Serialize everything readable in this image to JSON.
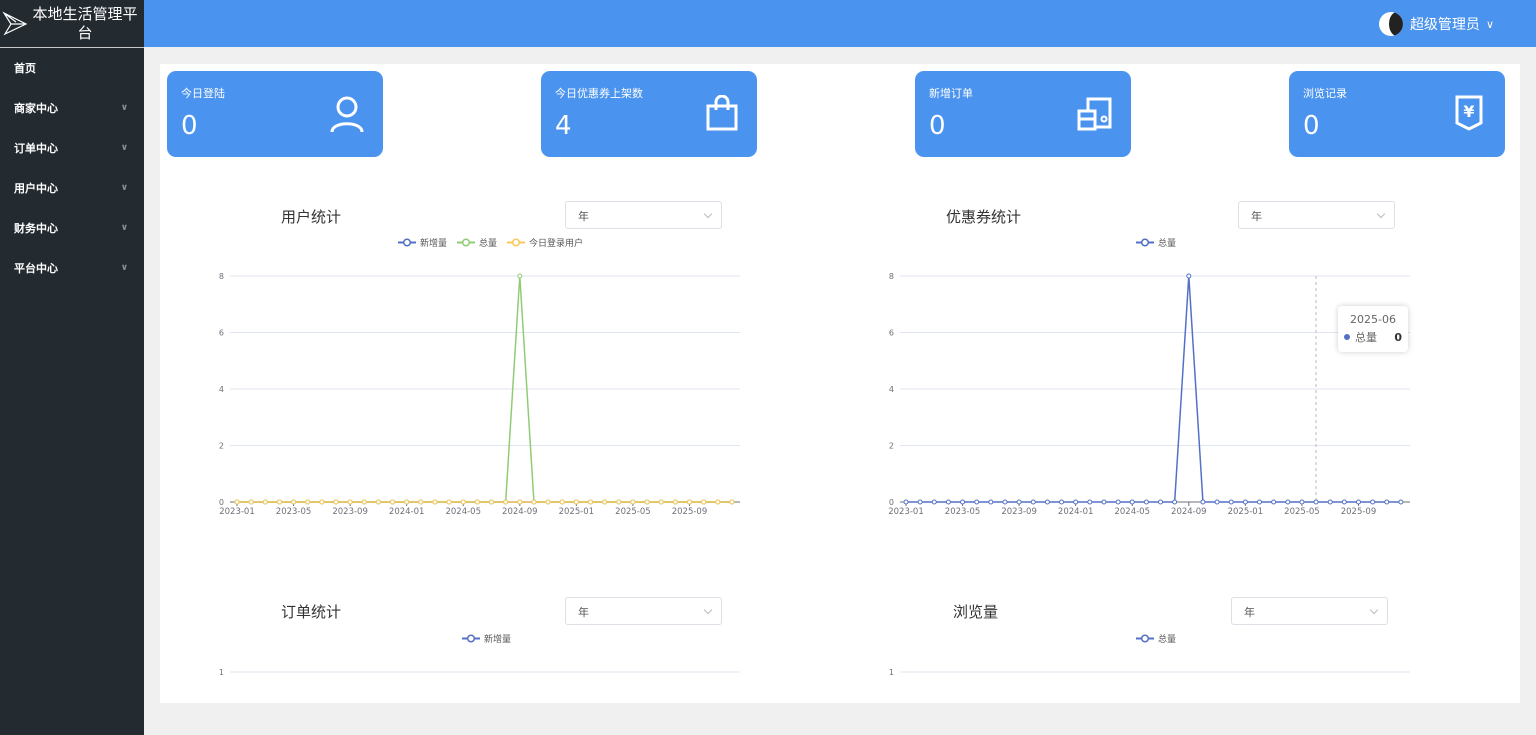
{
  "app": {
    "title": "本地生活管理平台"
  },
  "sidebar": {
    "items": [
      {
        "label": "首页",
        "expandable": false
      },
      {
        "label": "商家中心",
        "expandable": true
      },
      {
        "label": "订单中心",
        "expandable": true
      },
      {
        "label": "用户中心",
        "expandable": true
      },
      {
        "label": "财务中心",
        "expandable": true
      },
      {
        "label": "平台中心",
        "expandable": true
      }
    ]
  },
  "header": {
    "user": "超级管理员"
  },
  "cards": [
    {
      "title": "今日登陆",
      "value": "0",
      "icon": "user-icon"
    },
    {
      "title": "今日优惠券上架数",
      "value": "4",
      "icon": "shopping-bag-icon"
    },
    {
      "title": "新增订单",
      "value": "0",
      "icon": "clipboard-icon"
    },
    {
      "title": "浏览记录",
      "value": "0",
      "icon": "yen-icon"
    }
  ],
  "colors": {
    "accent": "#4a93ee",
    "sidebar": "#232a30",
    "blue": "#5470c6",
    "green": "#91cc75",
    "yellow": "#fac858"
  },
  "charts": [
    {
      "title": "用户统计",
      "select": "年"
    },
    {
      "title": "优惠券统计",
      "select": "年"
    },
    {
      "title": "订单统计",
      "select": "年"
    },
    {
      "title": "浏览量",
      "select": "年"
    }
  ],
  "tooltip": {
    "date": "2025-06",
    "series": "总量",
    "value": "0"
  },
  "chart_data": [
    {
      "type": "line",
      "x": [
        "2023-01",
        "2023-02",
        "2023-03",
        "2023-04",
        "2023-05",
        "2023-06",
        "2023-07",
        "2023-08",
        "2023-09",
        "2023-10",
        "2023-11",
        "2023-12",
        "2024-01",
        "2024-02",
        "2024-03",
        "2024-04",
        "2024-05",
        "2024-06",
        "2024-07",
        "2024-08",
        "2024-09",
        "2024-10",
        "2024-11",
        "2024-12",
        "2025-01",
        "2025-02",
        "2025-03",
        "2025-04",
        "2025-05",
        "2025-06",
        "2025-07",
        "2025-08",
        "2025-09",
        "2025-10",
        "2025-11",
        "2025-12"
      ],
      "xticks": [
        "2023-01",
        "2023-05",
        "2023-09",
        "2024-01",
        "2024-05",
        "2024-09",
        "2025-01",
        "2025-05",
        "2025-09"
      ],
      "yticks": [
        "0",
        "2",
        "4",
        "6",
        "8"
      ],
      "ylim": [
        0,
        8
      ],
      "series": [
        {
          "name": "新增量",
          "color": "#5470c6",
          "values": [
            0,
            0,
            0,
            0,
            0,
            0,
            0,
            0,
            0,
            0,
            0,
            0,
            0,
            0,
            0,
            0,
            0,
            0,
            0,
            0,
            0,
            0,
            0,
            0,
            0,
            0,
            0,
            0,
            0,
            0,
            0,
            0,
            0,
            0,
            0,
            0
          ]
        },
        {
          "name": "总量",
          "color": "#91cc75",
          "values": [
            0,
            0,
            0,
            0,
            0,
            0,
            0,
            0,
            0,
            0,
            0,
            0,
            0,
            0,
            0,
            0,
            0,
            0,
            0,
            0,
            8,
            0,
            0,
            0,
            0,
            0,
            0,
            0,
            0,
            0,
            0,
            0,
            0,
            0,
            0,
            0
          ]
        },
        {
          "name": "今日登录用户",
          "color": "#fac858",
          "values": [
            0,
            0,
            0,
            0,
            0,
            0,
            0,
            0,
            0,
            0,
            0,
            0,
            0,
            0,
            0,
            0,
            0,
            0,
            0,
            0,
            0,
            0,
            0,
            0,
            0,
            0,
            0,
            0,
            0,
            0,
            0,
            0,
            0,
            0,
            0,
            0
          ]
        }
      ]
    },
    {
      "type": "line",
      "x": "same as chart 1",
      "xticks": [
        "2023-01",
        "2023-05",
        "2023-09",
        "2024-01",
        "2024-05",
        "2024-09",
        "2025-01",
        "2025-05",
        "2025-09"
      ],
      "yticks": [
        "0",
        "2",
        "4",
        "6",
        "8"
      ],
      "ylim": [
        0,
        8
      ],
      "series": [
        {
          "name": "总量",
          "color": "#5470c6",
          "values": [
            0,
            0,
            0,
            0,
            0,
            0,
            0,
            0,
            0,
            0,
            0,
            0,
            0,
            0,
            0,
            0,
            0,
            0,
            0,
            0,
            8,
            0,
            0,
            0,
            0,
            0,
            0,
            0,
            0,
            0,
            0,
            0,
            0,
            0,
            0,
            0
          ]
        }
      ],
      "hover": "2025-06"
    },
    {
      "type": "line",
      "yticks": [
        "1"
      ],
      "series": [
        {
          "name": "新增量",
          "color": "#5470c6"
        }
      ]
    },
    {
      "type": "line",
      "yticks": [
        "1"
      ],
      "series": [
        {
          "name": "总量",
          "color": "#5470c6"
        }
      ]
    }
  ]
}
